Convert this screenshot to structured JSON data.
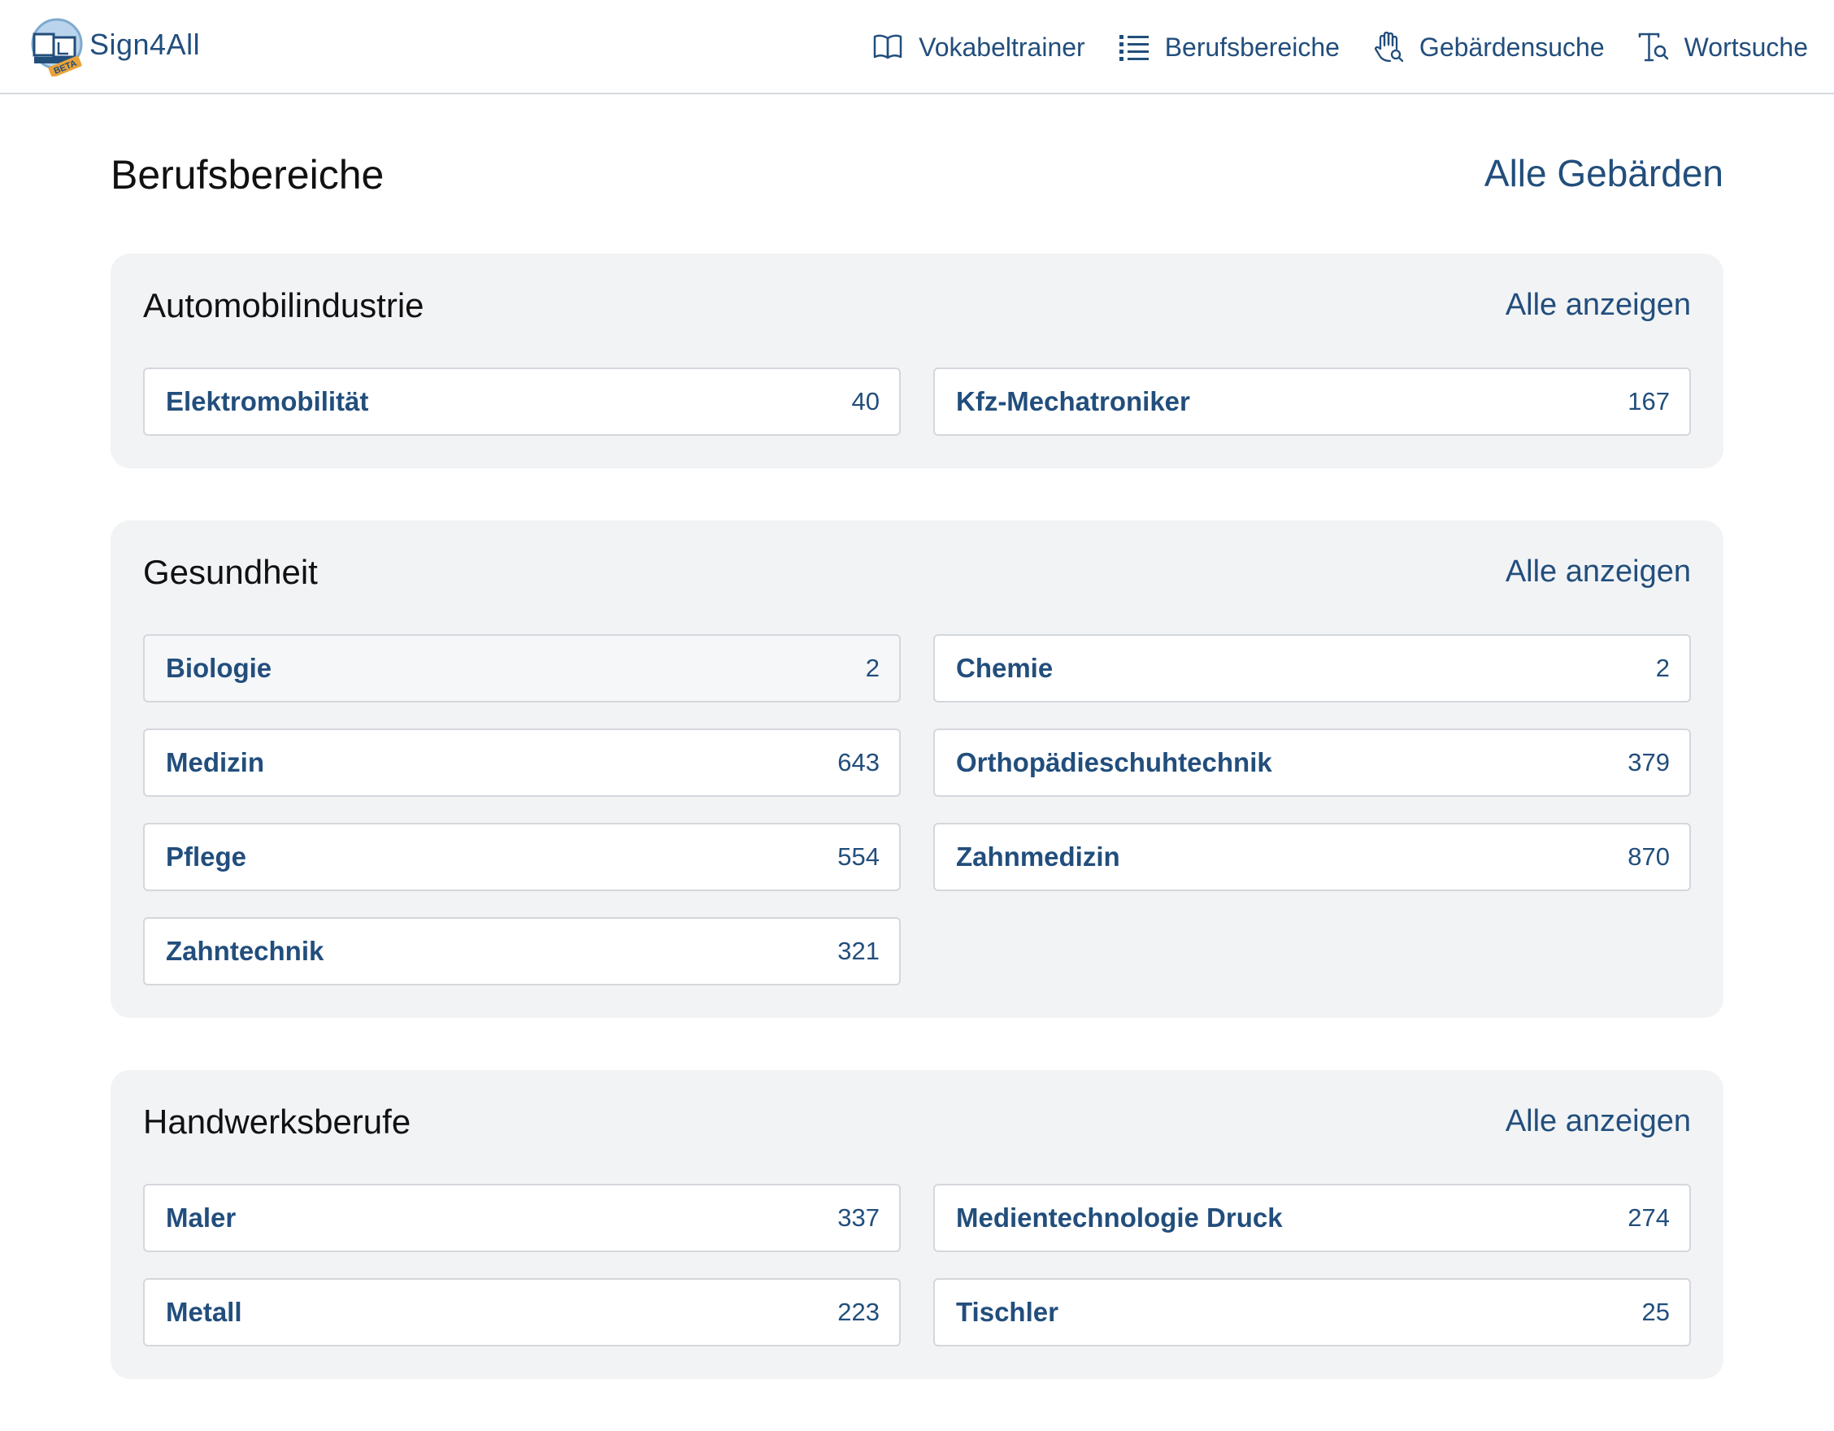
{
  "header": {
    "logo_text": "Sign4All",
    "logo_badge": "BETA",
    "nav": [
      {
        "label": "Vokabeltrainer",
        "icon": "book-icon"
      },
      {
        "label": "Berufsbereiche",
        "icon": "list-icon"
      },
      {
        "label": "Gebärdensuche",
        "icon": "hand-search-icon"
      },
      {
        "label": "Wortsuche",
        "icon": "text-search-icon"
      }
    ]
  },
  "page": {
    "title": "Berufsbereiche",
    "all_signs_link": "Alle Gebärden"
  },
  "sections": [
    {
      "title": "Automobilindustrie",
      "link": "Alle anzeigen",
      "items": [
        {
          "label": "Elektromobilität",
          "count": "40"
        },
        {
          "label": "Kfz-Mechatroniker",
          "count": "167"
        }
      ]
    },
    {
      "title": "Gesundheit",
      "link": "Alle anzeigen",
      "items": [
        {
          "label": "Biologie",
          "count": "2"
        },
        {
          "label": "Chemie",
          "count": "2"
        },
        {
          "label": "Medizin",
          "count": "643"
        },
        {
          "label": "Orthopädieschuhtechnik",
          "count": "379"
        },
        {
          "label": "Pflege",
          "count": "554"
        },
        {
          "label": "Zahnmedizin",
          "count": "870"
        },
        {
          "label": "Zahntechnik",
          "count": "321"
        }
      ]
    },
    {
      "title": "Handwerksberufe",
      "link": "Alle anzeigen",
      "items": [
        {
          "label": "Maler",
          "count": "337"
        },
        {
          "label": "Medientechnologie Druck",
          "count": "274"
        },
        {
          "label": "Metall",
          "count": "223"
        },
        {
          "label": "Tischler",
          "count": "25"
        }
      ]
    }
  ],
  "colors": {
    "accent": "#224e7c",
    "section_bg": "#f2f3f5",
    "border": "#d4d7dc",
    "logo_badge": "#e8a33a"
  }
}
